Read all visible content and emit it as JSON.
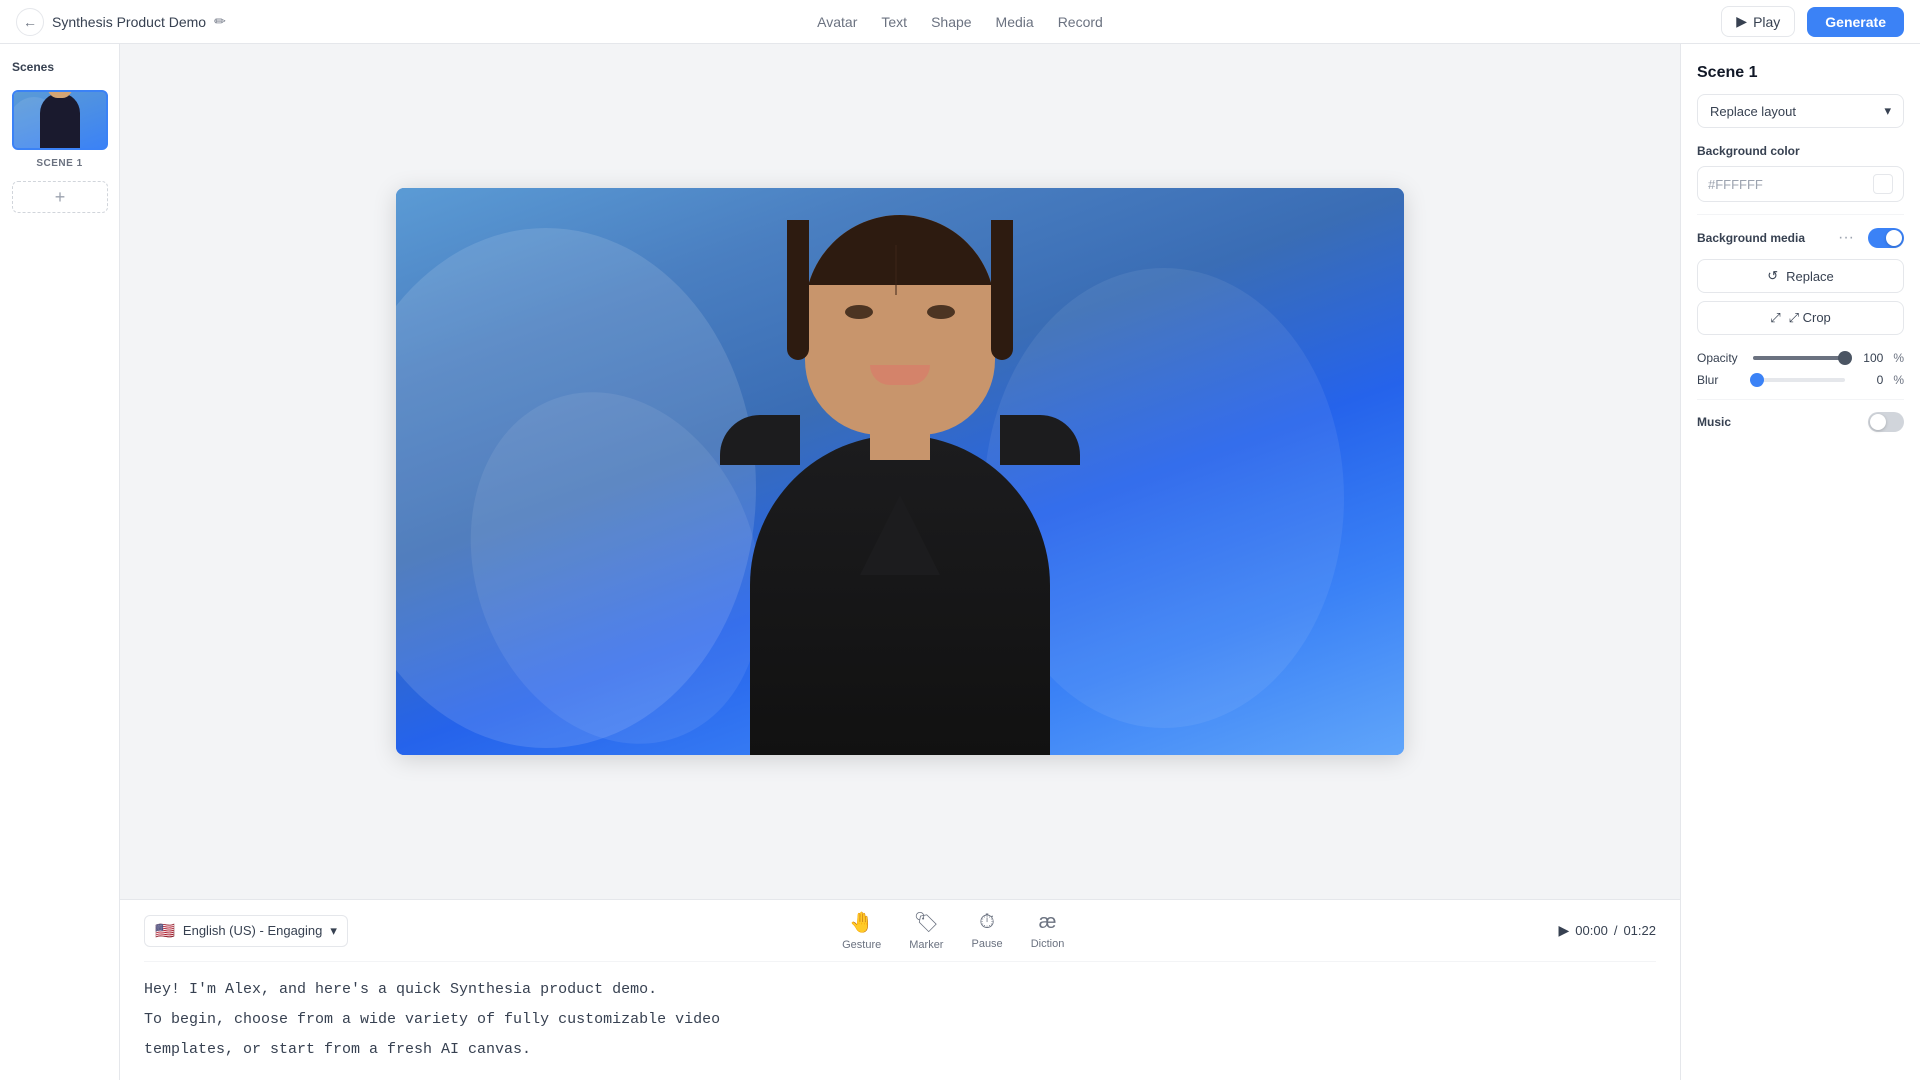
{
  "topbar": {
    "title": "Synthesis Product Demo",
    "edit_icon": "✏",
    "back_btn": "←",
    "nav_items": [
      "Avatar",
      "Text",
      "Shape",
      "Media",
      "Record"
    ],
    "play_label": "Play",
    "generate_label": "Generate"
  },
  "scenes": {
    "title": "Scenes",
    "scene1_label": "SCENE 1",
    "add_btn": "+"
  },
  "bottom_controls": {
    "language": "English (US) - Engaging",
    "chevron": "▾",
    "gesture_label": "Gesture",
    "marker_label": "Marker",
    "pause_label": "Pause",
    "diction_label": "Diction",
    "time_current": "00:00",
    "time_total": "01:22",
    "time_sep": "/"
  },
  "script": {
    "line1": "Hey! I'm Alex, and here's a quick Synthesia product demo.",
    "line2": "To begin, choose from a wide variety of fully customizable video",
    "line3": "templates, or start from a fresh AI canvas."
  },
  "right_panel": {
    "scene_title": "Scene 1",
    "replace_layout_label": "Replace layout",
    "bg_color_label": "Background color",
    "bg_color_value": "#FFFFFF",
    "bg_media_label": "Background media",
    "more_btn": "···",
    "replace_btn": "↺  Replace",
    "crop_btn": "⤢  Crop",
    "opacity_label": "Opacity",
    "opacity_value": "100",
    "opacity_unit": "%",
    "blur_label": "Blur",
    "blur_value": "0",
    "blur_unit": "%",
    "music_label": "Music"
  }
}
